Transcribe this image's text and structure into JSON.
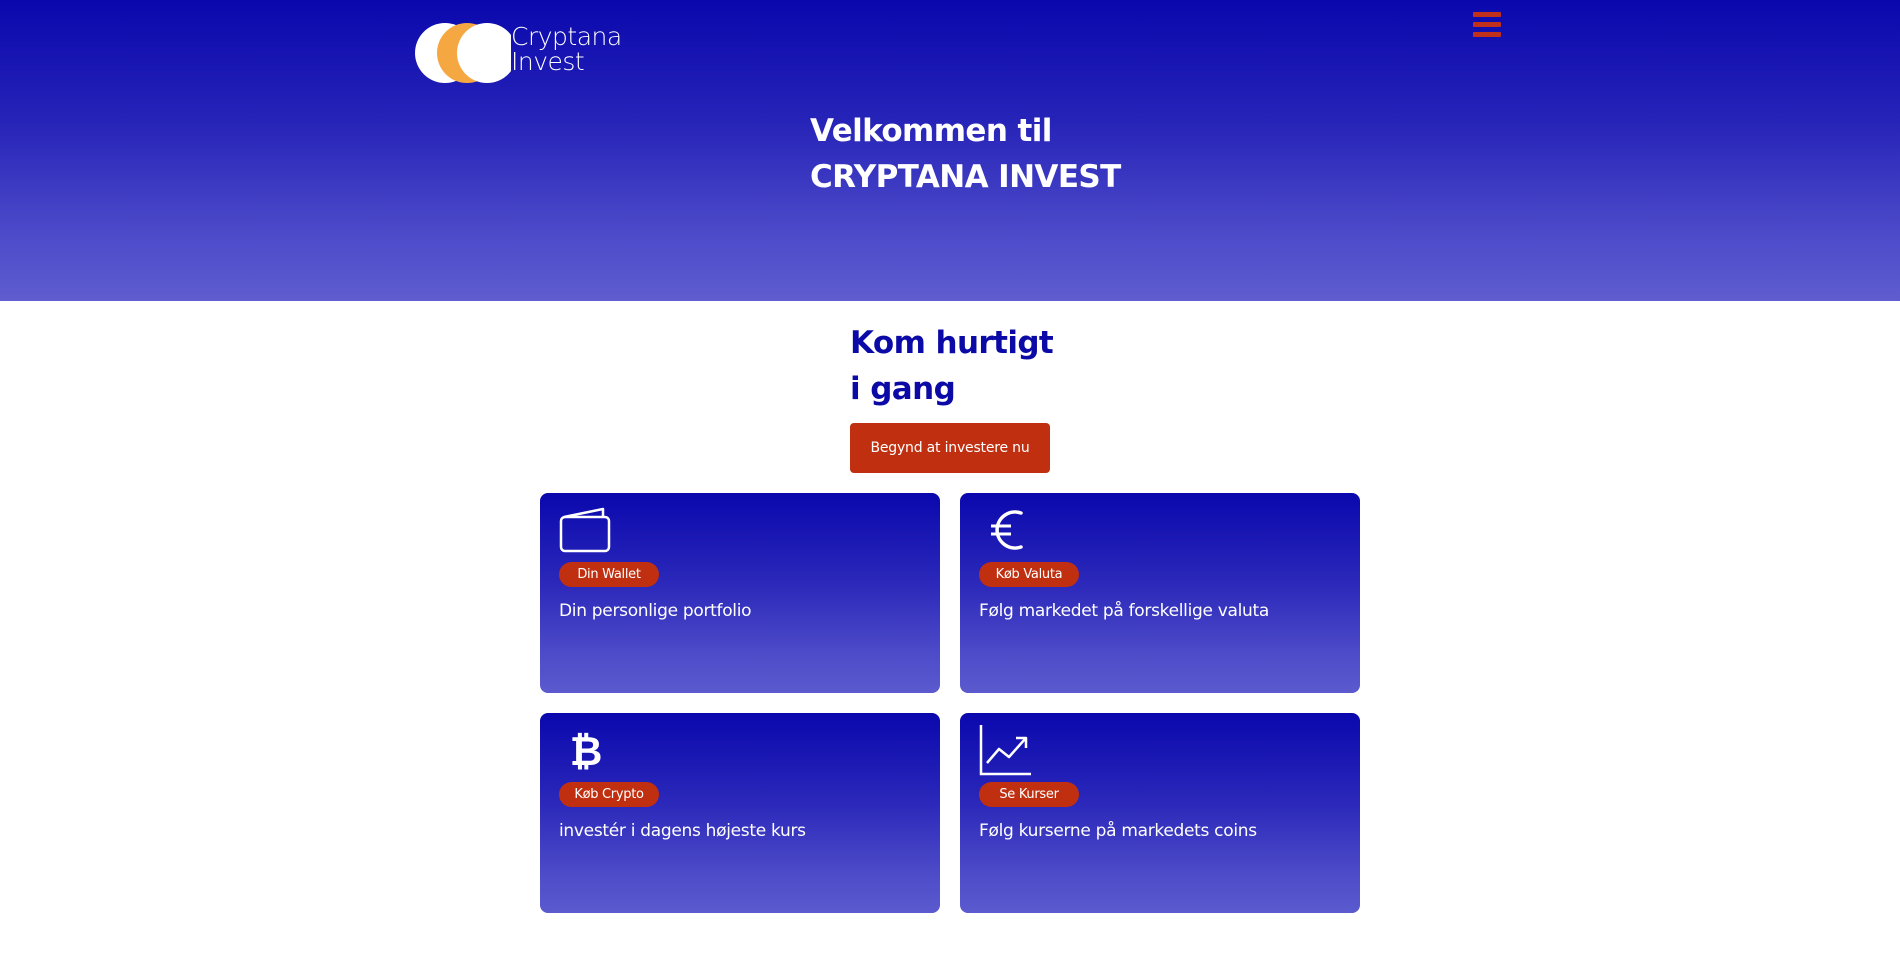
{
  "header": {
    "logo_line1": "Cryptana",
    "logo_line2": "Invest",
    "menu_icon": "hamburger-menu-icon",
    "title_line1": "Velkommen til",
    "title_line2": "CRYPTANA INVEST"
  },
  "main": {
    "heading_line1": "Kom hurtigt",
    "heading_line2": "i gang",
    "cta_label": "Begynd at investere nu"
  },
  "cards": [
    {
      "icon": "wallet-icon",
      "badge": "Din Wallet",
      "description": "Din personlige portfolio"
    },
    {
      "icon": "euro-icon",
      "badge": "Køb Valuta",
      "description": "Følg markedet på forskellige valuta"
    },
    {
      "icon": "bitcoin-icon",
      "badge": "Køb Crypto",
      "description": "investér i dagens højeste kurs"
    },
    {
      "icon": "chart-line-icon",
      "badge": "Se Kurser",
      "description": "Følg kurserne på markedets coins"
    }
  ],
  "colors": {
    "primary_blue": "#0a08ad",
    "accent_red": "#c03010",
    "logo_orange": "#f5a742"
  }
}
